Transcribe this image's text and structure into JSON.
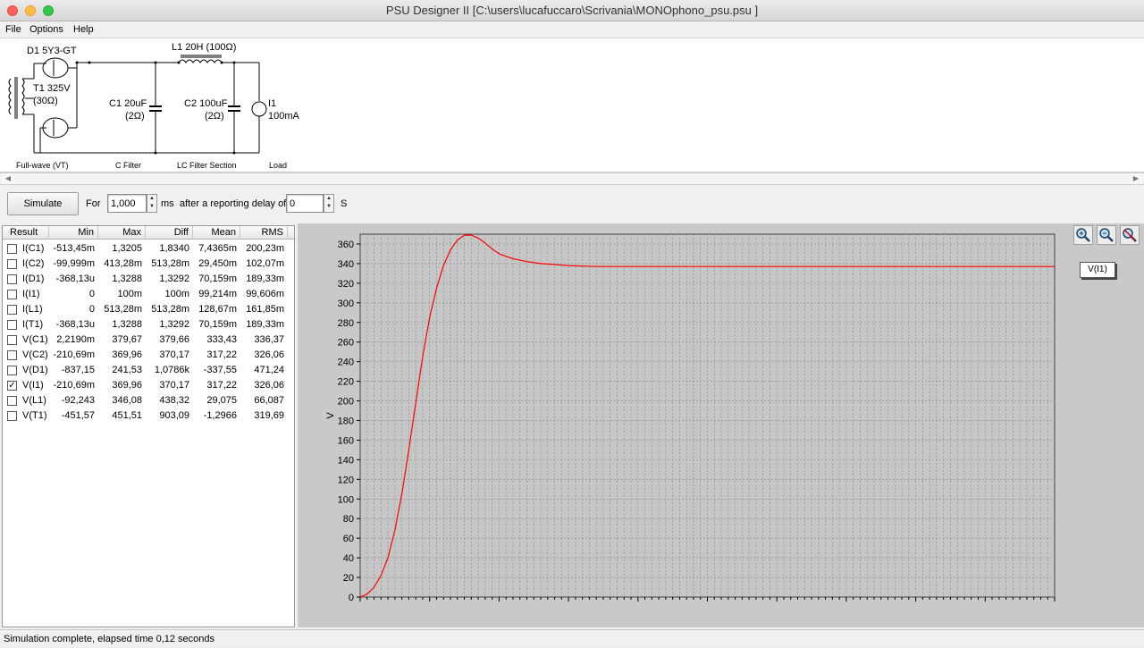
{
  "window": {
    "title": "PSU Designer II  [C:\\users\\lucafuccaro\\Scrivania\\MONOphono_psu.psu ]"
  },
  "menu": [
    {
      "label": "File"
    },
    {
      "label": "Options"
    },
    {
      "label": "Help"
    }
  ],
  "schematic": {
    "d1": "D1 5Y3-GT",
    "t1": "T1 325V",
    "t1_r": "(30Ω)",
    "l1": "L1 20H (100Ω)",
    "c1": "C1 20uF",
    "c1_r": "(2Ω)",
    "c2": "C2 100uF",
    "c2_r": "(2Ω)",
    "i1": "I1",
    "i1_val": "100mA",
    "sections": [
      "Full-wave (VT)",
      "C Filter",
      "LC Filter Section",
      "Load"
    ]
  },
  "toolbar": {
    "simulate": "Simulate",
    "for": "For",
    "duration": "1,000",
    "ms": "ms",
    "after": "after a reporting delay of",
    "delay": "0",
    "s": "S"
  },
  "results": {
    "headers": [
      "Result",
      "Min",
      "Max",
      "Diff",
      "Mean",
      "RMS"
    ],
    "rows": [
      {
        "checked": false,
        "name": "I(C1)",
        "min": "-513,45m",
        "max": "1,3205",
        "diff": "1,8340",
        "mean": "7,4365m",
        "rms": "200,23m"
      },
      {
        "checked": false,
        "name": "I(C2)",
        "min": "-99,999m",
        "max": "413,28m",
        "diff": "513,28m",
        "mean": "29,450m",
        "rms": "102,07m"
      },
      {
        "checked": false,
        "name": "I(D1)",
        "min": "-368,13u",
        "max": "1,3288",
        "diff": "1,3292",
        "mean": "70,159m",
        "rms": "189,33m"
      },
      {
        "checked": false,
        "name": "I(I1)",
        "min": "0",
        "max": "100m",
        "diff": "100m",
        "mean": "99,214m",
        "rms": "99,606m"
      },
      {
        "checked": false,
        "name": "I(L1)",
        "min": "0",
        "max": "513,28m",
        "diff": "513,28m",
        "mean": "128,67m",
        "rms": "161,85m"
      },
      {
        "checked": false,
        "name": "I(T1)",
        "min": "-368,13u",
        "max": "1,3288",
        "diff": "1,3292",
        "mean": "70,159m",
        "rms": "189,33m"
      },
      {
        "checked": false,
        "name": "V(C1)",
        "min": "2,2190m",
        "max": "379,67",
        "diff": "379,66",
        "mean": "333,43",
        "rms": "336,37"
      },
      {
        "checked": false,
        "name": "V(C2)",
        "min": "-210,69m",
        "max": "369,96",
        "diff": "370,17",
        "mean": "317,22",
        "rms": "326,06"
      },
      {
        "checked": false,
        "name": "V(D1)",
        "min": "-837,15",
        "max": "241,53",
        "diff": "1,0786k",
        "mean": "-337,55",
        "rms": "471,24"
      },
      {
        "checked": true,
        "name": "V(I1)",
        "min": "-210,69m",
        "max": "369,96",
        "diff": "370,17",
        "mean": "317,22",
        "rms": "326,06"
      },
      {
        "checked": false,
        "name": "V(L1)",
        "min": "-92,243",
        "max": "346,08",
        "diff": "438,32",
        "mean": "29,075",
        "rms": "66,087"
      },
      {
        "checked": false,
        "name": "V(T1)",
        "min": "-451,57",
        "max": "451,51",
        "diff": "903,09",
        "mean": "-1,2966",
        "rms": "319,69"
      }
    ]
  },
  "chart_data": {
    "type": "line",
    "ylabel": "V",
    "ylim": [
      0,
      370
    ],
    "yticks": [
      0,
      20,
      40,
      60,
      80,
      100,
      120,
      140,
      160,
      180,
      200,
      220,
      240,
      260,
      280,
      300,
      320,
      340,
      360
    ],
    "xlim": [
      0,
      1000
    ],
    "grid": true,
    "line_color": "#ff0000",
    "series": [
      {
        "name": "V(I1)",
        "x": [
          0,
          10,
          20,
          30,
          40,
          50,
          60,
          70,
          80,
          90,
          100,
          110,
          120,
          130,
          140,
          150,
          160,
          170,
          180,
          190,
          200,
          220,
          240,
          260,
          280,
          300,
          340,
          400,
          500,
          600,
          700,
          800,
          900,
          1000
        ],
        "y": [
          0,
          3,
          10,
          22,
          40,
          68,
          105,
          150,
          198,
          245,
          285,
          315,
          338,
          354,
          364,
          369,
          369,
          366,
          361,
          355,
          350,
          345,
          342,
          340,
          339,
          338,
          337,
          337,
          337,
          337,
          337,
          337,
          337,
          337
        ]
      }
    ]
  },
  "zoom": [
    "zoom-in-icon",
    "zoom-out-icon",
    "zoom-reset-icon"
  ],
  "status": "Simulation complete, elapsed time 0,12 seconds"
}
